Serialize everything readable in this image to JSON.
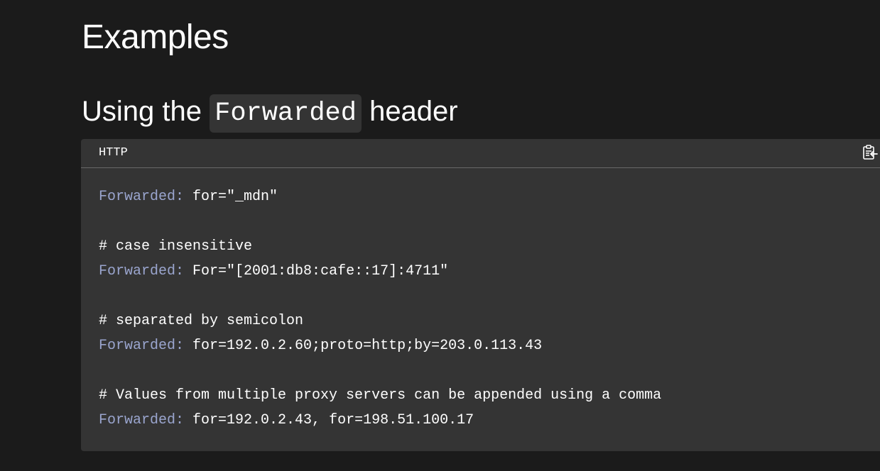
{
  "section": {
    "title": "Examples"
  },
  "subsection": {
    "title_before": "Using the ",
    "title_code": "Forwarded",
    "title_after": " header"
  },
  "code_example": {
    "language": "HTTP",
    "copy_icon": "clipboard-copy-icon",
    "lines": [
      {
        "key": "Forwarded:",
        "value": " for=\"_mdn\""
      },
      {
        "text": ""
      },
      {
        "text": "# case insensitive"
      },
      {
        "key": "Forwarded:",
        "value": " For=\"[2001:db8:cafe::17]:4711\""
      },
      {
        "text": ""
      },
      {
        "text": "# separated by semicolon"
      },
      {
        "key": "Forwarded:",
        "value": " for=192.0.2.60;proto=http;by=203.0.113.43"
      },
      {
        "text": ""
      },
      {
        "text": "# Values from multiple proxy servers can be appended using a comma"
      },
      {
        "key": "Forwarded:",
        "value": " for=192.0.2.43, for=198.51.100.17"
      }
    ]
  },
  "colors": {
    "background": "#1b1b1b",
    "code_background": "#343434",
    "header_key": "#9aa5ce",
    "text": "#ffffff"
  }
}
